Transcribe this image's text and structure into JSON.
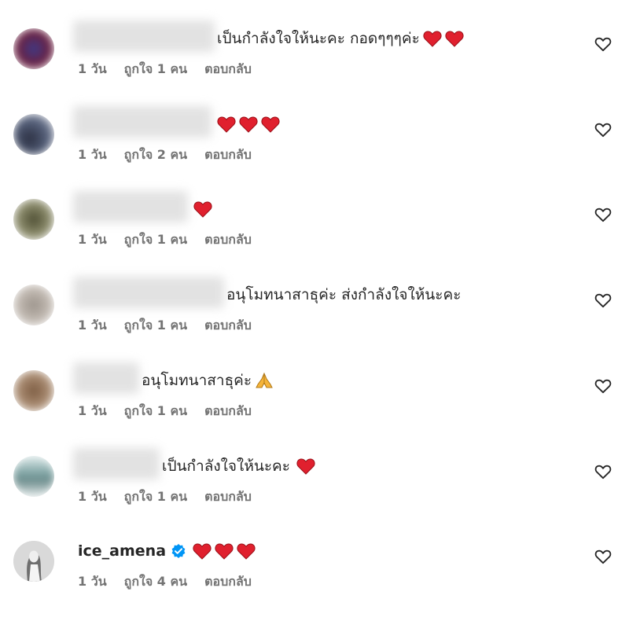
{
  "comments": [
    {
      "text": "เป็นกำลังใจให้นะคะ กอดๆๆๆค่ะ",
      "hearts": 2,
      "meta": {
        "age": "1 วัน",
        "likes": "ถูกใจ 1 คน",
        "reply": "ตอบกลับ"
      },
      "avatar_color": "#5a2a4a"
    },
    {
      "text": "",
      "hearts": 3,
      "meta": {
        "age": "1 วัน",
        "likes": "ถูกใจ 2 คน",
        "reply": "ตอบกลับ"
      },
      "avatar_color": "#3a3f55"
    },
    {
      "text": "",
      "hearts": 1,
      "meta": {
        "age": "1 วัน",
        "likes": "ถูกใจ 1 คน",
        "reply": "ตอบกลับ"
      },
      "avatar_color": "#6b6a4a"
    },
    {
      "text": "อนุโมทนาสาธุค่ะ ส่งกำลังใจให้นะคะ",
      "hearts": 0,
      "meta": {
        "age": "1 วัน",
        "likes": "ถูกใจ 1 คน",
        "reply": "ตอบกลับ"
      },
      "avatar_color": "#b0a8a0"
    },
    {
      "text": "อนุโมทนาสาธุค่ะ",
      "hearts": 0,
      "emoji": "folded-hands",
      "meta": {
        "age": "1 วัน",
        "likes": "ถูกใจ 1 คน",
        "reply": "ตอบกลับ"
      },
      "avatar_color": "#a0806a"
    },
    {
      "text": "เป็นกำลังใจให้นะคะ",
      "hearts": 1,
      "meta": {
        "age": "1 วัน",
        "likes": "ถูกใจ 1 คน",
        "reply": "ตอบกลับ"
      },
      "avatar_color": "#8aa8a8"
    },
    {
      "username": "ice_amena",
      "verified": true,
      "text": "",
      "hearts": 3,
      "meta": {
        "age": "1 วัน",
        "likes": "ถูกใจ 4 คน",
        "reply": "ตอบกลับ"
      },
      "avatar_color": "#d8d8d8"
    }
  ],
  "icons": {
    "like": "heart-outline-icon",
    "heart_emoji": "red-heart-emoji",
    "verified": "verified-badge-icon"
  },
  "colors": {
    "heart": "#e0202e",
    "verified": "#0095f6",
    "meta_text": "#737373"
  }
}
